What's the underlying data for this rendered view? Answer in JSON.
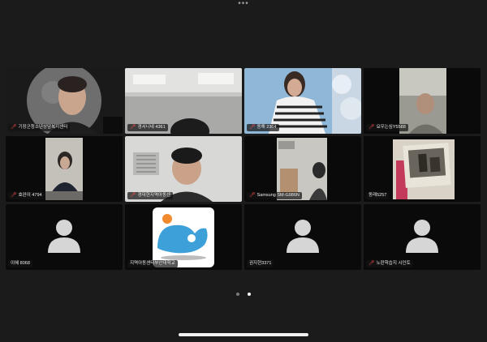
{
  "top_handle": "•••",
  "participants": [
    {
      "name": "기장군청소년상담복지센터",
      "muted": true,
      "active": false,
      "video": true
    },
    {
      "name": "경서니네 4361",
      "muted": true,
      "active": false,
      "video": true
    },
    {
      "name": "동해 2364",
      "muted": true,
      "active": false,
      "video": true
    },
    {
      "name": "요우는심Y5588",
      "muted": true,
      "active": false,
      "video": true
    },
    {
      "name": "효완이 4794",
      "muted": true,
      "active": false,
      "video": true
    },
    {
      "name": "경대현지역아동센",
      "muted": true,
      "active": false,
      "video": true
    },
    {
      "name": "Samsung SM-G986N",
      "muted": true,
      "active": true,
      "video": true
    },
    {
      "name": "동래5257",
      "muted": false,
      "active": false,
      "video": true
    },
    {
      "name": "이혜 8068",
      "muted": false,
      "active": false,
      "video": false
    },
    {
      "name": "지역아동센터부산대학교",
      "muted": false,
      "active": false,
      "video": false
    },
    {
      "name": "권지현3371",
      "muted": false,
      "active": false,
      "video": false
    },
    {
      "name": "노란학습지 시인토",
      "muted": true,
      "active": false,
      "video": false
    }
  ],
  "pagination": {
    "total_pages": 2,
    "current_page": 2
  },
  "colors": {
    "active_border": "#3bb35a",
    "muted_icon": "#ff4b4b",
    "background": "#1b1b1b"
  }
}
